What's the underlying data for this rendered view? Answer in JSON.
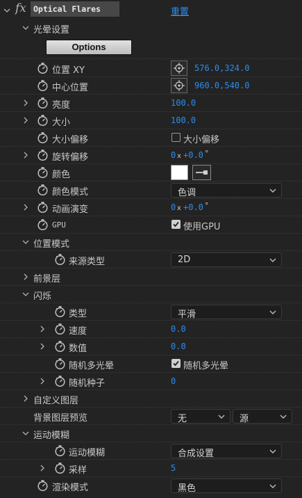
{
  "header": {
    "fx_label": "fx",
    "effect_name": "Optical Flares",
    "reset_label": "重置"
  },
  "flare_settings": {
    "label": "光晕设置",
    "options_button": "Options"
  },
  "position_xy": {
    "label": "位置 XY",
    "value": "576.0,324.0"
  },
  "center_position": {
    "label": "中心位置",
    "value": "960.0,540.0"
  },
  "brightness": {
    "label": "亮度",
    "value": "100.0"
  },
  "size": {
    "label": "大小",
    "value": "100.0"
  },
  "size_offset": {
    "label": "大小偏移",
    "checkbox_label": "大小偏移",
    "checked": false
  },
  "rotation_offset": {
    "label": "旋转偏移",
    "value_rev": "0",
    "value_x": "x",
    "value_deg": "+0.0",
    "degree": "°"
  },
  "color": {
    "label": "颜色",
    "swatch": "#ffffff"
  },
  "color_mode": {
    "label": "颜色模式",
    "selected": "色调"
  },
  "animation_evolution": {
    "label": "动画演变",
    "value_rev": "0",
    "value_x": "x",
    "value_deg": "+0.0",
    "degree": "°"
  },
  "gpu": {
    "label": "GPU",
    "checkbox_label": "使用GPU",
    "checked": true
  },
  "position_mode": {
    "label": "位置模式",
    "source_type": {
      "label": "来源类型",
      "selected": "2D"
    }
  },
  "foreground_layers": {
    "label": "前景层"
  },
  "flicker": {
    "label": "闪烁",
    "type": {
      "label": "类型",
      "selected": "平滑"
    },
    "speed": {
      "label": "速度",
      "value": "0.0"
    },
    "amount": {
      "label": "数值",
      "value": "0.0"
    },
    "random_multi_glow": {
      "label": "随机多光晕",
      "checkbox_label": "随机多光晕",
      "checked": true
    },
    "random_seed": {
      "label": "随机种子",
      "value": "0"
    }
  },
  "custom_layers": {
    "label": "自定义图层"
  },
  "background_preview": {
    "label": "背景图层预览",
    "selected_1": "无",
    "selected_2": "源"
  },
  "motion_blur": {
    "label": "运动模糊",
    "blur": {
      "label": "运动模糊",
      "selected": "合成设置"
    },
    "samples": {
      "label": "采样",
      "value": "5"
    }
  },
  "render_mode": {
    "label": "渲染模式",
    "selected": "黑色"
  },
  "colors": {
    "accent": "#2d8ceb",
    "background": "#232323",
    "header_bg": "#3a3a3a"
  }
}
